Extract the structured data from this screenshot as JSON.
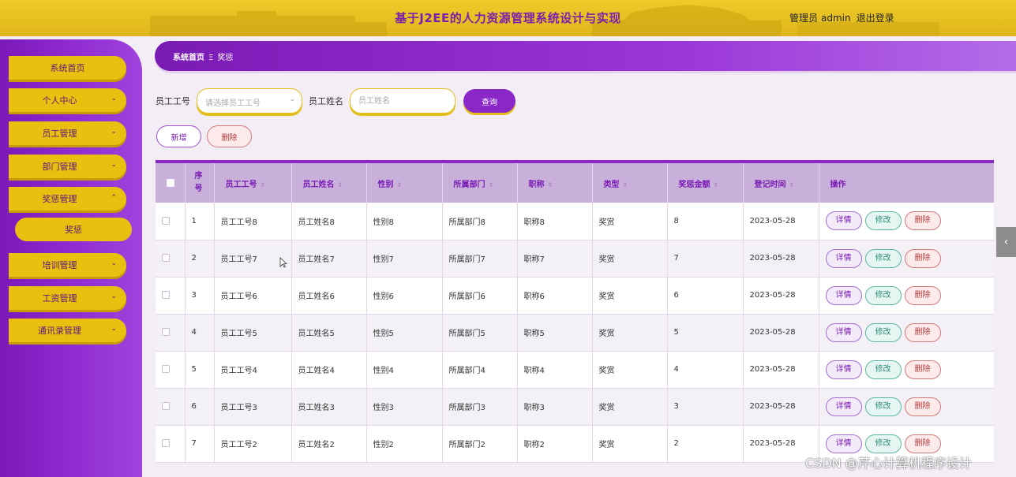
{
  "header": {
    "title": "基于J2EE的人力资源管理系统设计与实现",
    "user_role": "管理员",
    "username": "admin",
    "logout": "退出登录"
  },
  "sidebar": {
    "items": [
      {
        "label": "系统首页"
      },
      {
        "label": "个人中心"
      },
      {
        "label": "员工管理"
      },
      {
        "label": "部门管理"
      },
      {
        "label": "奖惩管理"
      },
      {
        "label": "奖惩"
      },
      {
        "label": "培训管理"
      },
      {
        "label": "工资管理"
      },
      {
        "label": "通讯录管理"
      }
    ]
  },
  "breadcrumb": {
    "home": "系统首页",
    "separator": "Ξ",
    "current": "奖惩"
  },
  "search": {
    "emp_no_label": "员工工号",
    "emp_no_placeholder": "请选择员工工号",
    "emp_name_label": "员工姓名",
    "emp_name_placeholder": "员工姓名",
    "query_button": "查询"
  },
  "actions": {
    "add": "新增",
    "delete": "删除"
  },
  "table": {
    "headers": {
      "index": "序号",
      "emp_no": "员工工号",
      "emp_name": "员工姓名",
      "gender": "性别",
      "dept": "所属部门",
      "title": "职称",
      "type": "类型",
      "amount": "奖惩金额",
      "date": "登记时间",
      "ops": "操作"
    },
    "op_labels": {
      "detail": "详情",
      "edit": "修改",
      "delete": "删除"
    },
    "rows": [
      {
        "index": "1",
        "emp_no": "员工工号8",
        "emp_name": "员工姓名8",
        "gender": "性别8",
        "dept": "所属部门8",
        "title": "职称8",
        "type": "奖赏",
        "amount": "8",
        "date": "2023-05-28"
      },
      {
        "index": "2",
        "emp_no": "员工工号7",
        "emp_name": "员工姓名7",
        "gender": "性别7",
        "dept": "所属部门7",
        "title": "职称7",
        "type": "奖赏",
        "amount": "7",
        "date": "2023-05-28"
      },
      {
        "index": "3",
        "emp_no": "员工工号6",
        "emp_name": "员工姓名6",
        "gender": "性别6",
        "dept": "所属部门6",
        "title": "职称6",
        "type": "奖赏",
        "amount": "6",
        "date": "2023-05-28"
      },
      {
        "index": "4",
        "emp_no": "员工工号5",
        "emp_name": "员工姓名5",
        "gender": "性别5",
        "dept": "所属部门5",
        "title": "职称5",
        "type": "奖赏",
        "amount": "5",
        "date": "2023-05-28"
      },
      {
        "index": "5",
        "emp_no": "员工工号4",
        "emp_name": "员工姓名4",
        "gender": "性别4",
        "dept": "所属部门4",
        "title": "职称4",
        "type": "奖赏",
        "amount": "4",
        "date": "2023-05-28"
      },
      {
        "index": "6",
        "emp_no": "员工工号3",
        "emp_name": "员工姓名3",
        "gender": "性别3",
        "dept": "所属部门3",
        "title": "职称3",
        "type": "奖赏",
        "amount": "3",
        "date": "2023-05-28"
      },
      {
        "index": "7",
        "emp_no": "员工工号2",
        "emp_name": "员工姓名2",
        "gender": "性别2",
        "dept": "所属部门2",
        "title": "职称2",
        "type": "奖赏",
        "amount": "2",
        "date": "2023-05-28"
      }
    ]
  },
  "watermark": "CSDN @芹心计算机程序设计",
  "colors": {
    "accent_purple": "#8a27c9",
    "accent_yellow": "#e9bf10"
  }
}
